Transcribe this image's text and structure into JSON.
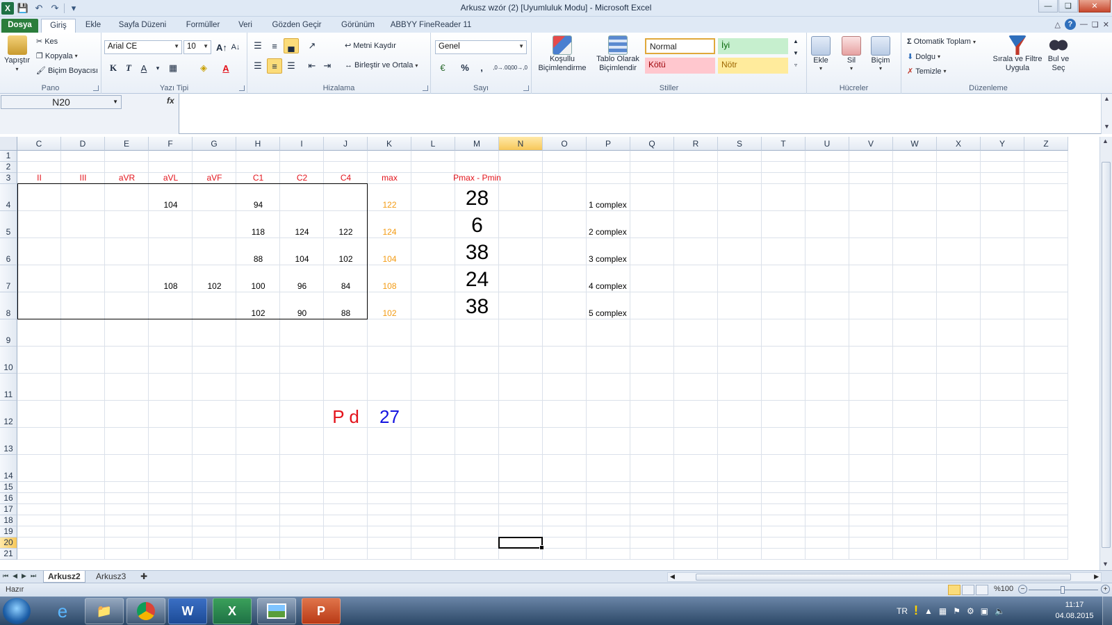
{
  "window": {
    "title": "Arkusz wzór (2)  [Uyumluluk Modu]  -  Microsoft Excel",
    "app_icon": "X"
  },
  "tabs": [
    "Dosya",
    "Giriş",
    "Ekle",
    "Sayfa Düzeni",
    "Formüller",
    "Veri",
    "Gözden Geçir",
    "Görünüm",
    "ABBYY FineReader 11"
  ],
  "ribbon": {
    "clipboard": {
      "label": "Pano",
      "paste": "Yapıştır",
      "cut": "Kes",
      "copy": "Kopyala",
      "format_painter": "Biçim Boyacısı"
    },
    "font": {
      "label": "Yazı Tipi",
      "name": "Arial CE",
      "size": "10",
      "bold": "K",
      "italic": "T",
      "underline": "A",
      "font_color_letter": "A"
    },
    "alignment": {
      "label": "Hizalama",
      "wrap": "Metni Kaydır",
      "merge": "Birleştir ve Ortala"
    },
    "number": {
      "label": "Sayı",
      "format": "Genel",
      "percent": "%",
      "comma": ",",
      "inc_dec": ",0→.00",
      "dec_dec": ",00→,0"
    },
    "styles": {
      "label": "Stiller",
      "conditional": "Koşullu Biçimlendirme",
      "as_table": "Tablo Olarak Biçimlendir",
      "normal": "Normal",
      "good": "İyi",
      "bad": "Kötü",
      "neutral": "Nötr",
      "colors": {
        "good_bg": "#c6efce",
        "good_fg": "#006100",
        "bad_bg": "#ffc7ce",
        "bad_fg": "#9c0006",
        "neutral_bg": "#ffeb9c",
        "neutral_fg": "#9c6500"
      }
    },
    "cells": {
      "label": "Hücreler",
      "insert": "Ekle",
      "delete": "Sil",
      "format": "Biçim"
    },
    "editing": {
      "label": "Düzenleme",
      "autosum": "Otomatik Toplam",
      "fill": "Dolgu",
      "clear": "Temizle",
      "sort": "Sırala ve Filtre Uygula",
      "find": "Bul ve Seç"
    }
  },
  "formula_bar": {
    "name_box": "N20",
    "fx": "fx",
    "content": ""
  },
  "columns": [
    "C",
    "D",
    "E",
    "F",
    "G",
    "H",
    "I",
    "J",
    "K",
    "L",
    "M",
    "N",
    "O",
    "P",
    "Q",
    "R",
    "S",
    "T",
    "U",
    "V",
    "W",
    "X",
    "Y",
    "Z"
  ],
  "rows": [
    "1",
    "2",
    "3",
    "4",
    "5",
    "6",
    "7",
    "8",
    "9",
    "10",
    "11",
    "12",
    "13",
    "14",
    "15",
    "16",
    "17",
    "18",
    "19",
    "20",
    "21"
  ],
  "selected_cell": {
    "column": "N",
    "row": "20"
  },
  "sheet": {
    "headers": {
      "C": "II",
      "D": "III",
      "E": "aVR",
      "F": "aVL",
      "G": "aVF",
      "H": "C1",
      "I": "C2",
      "J": "C4",
      "K": "max",
      "M": "Pmax - Pmin"
    },
    "data_rows": [
      {
        "F": "104",
        "G": "",
        "H": "94",
        "I": "",
        "J": "",
        "K": "122",
        "M": "28",
        "P": "1 complex"
      },
      {
        "F": "",
        "G": "",
        "H": "118",
        "I": "124",
        "J": "122",
        "K": "124",
        "M": "6",
        "P": "2 complex"
      },
      {
        "F": "",
        "G": "",
        "H": "88",
        "I": "104",
        "J": "102",
        "K": "104",
        "M": "38",
        "P": "3 complex"
      },
      {
        "F": "108",
        "G": "102",
        "H": "100",
        "I": "96",
        "J": "84",
        "K": "108",
        "M": "24",
        "P": "4 complex"
      },
      {
        "F": "",
        "G": "",
        "H": "102",
        "I": "90",
        "J": "88",
        "K": "102",
        "M": "38",
        "P": "5 complex"
      }
    ],
    "pd_label": "P d",
    "pd_value": "27",
    "colors": {
      "header_red": "#e3131b",
      "max_orange": "#f39a11",
      "pd_blue": "#1414e0"
    }
  },
  "sheet_tabs": [
    "Arkusz2",
    "Arkusz3"
  ],
  "active_sheet": "Arkusz2",
  "status": {
    "ready": "Hazır",
    "zoom": "%100"
  },
  "taskbar": {
    "lang": "TR",
    "time": "11:17",
    "date": "04.08.2015",
    "apps": [
      "ie-icon",
      "explorer-icon",
      "chrome-icon",
      "word-icon",
      "excel-icon",
      "photo-viewer-icon",
      "powerpoint-icon"
    ]
  }
}
